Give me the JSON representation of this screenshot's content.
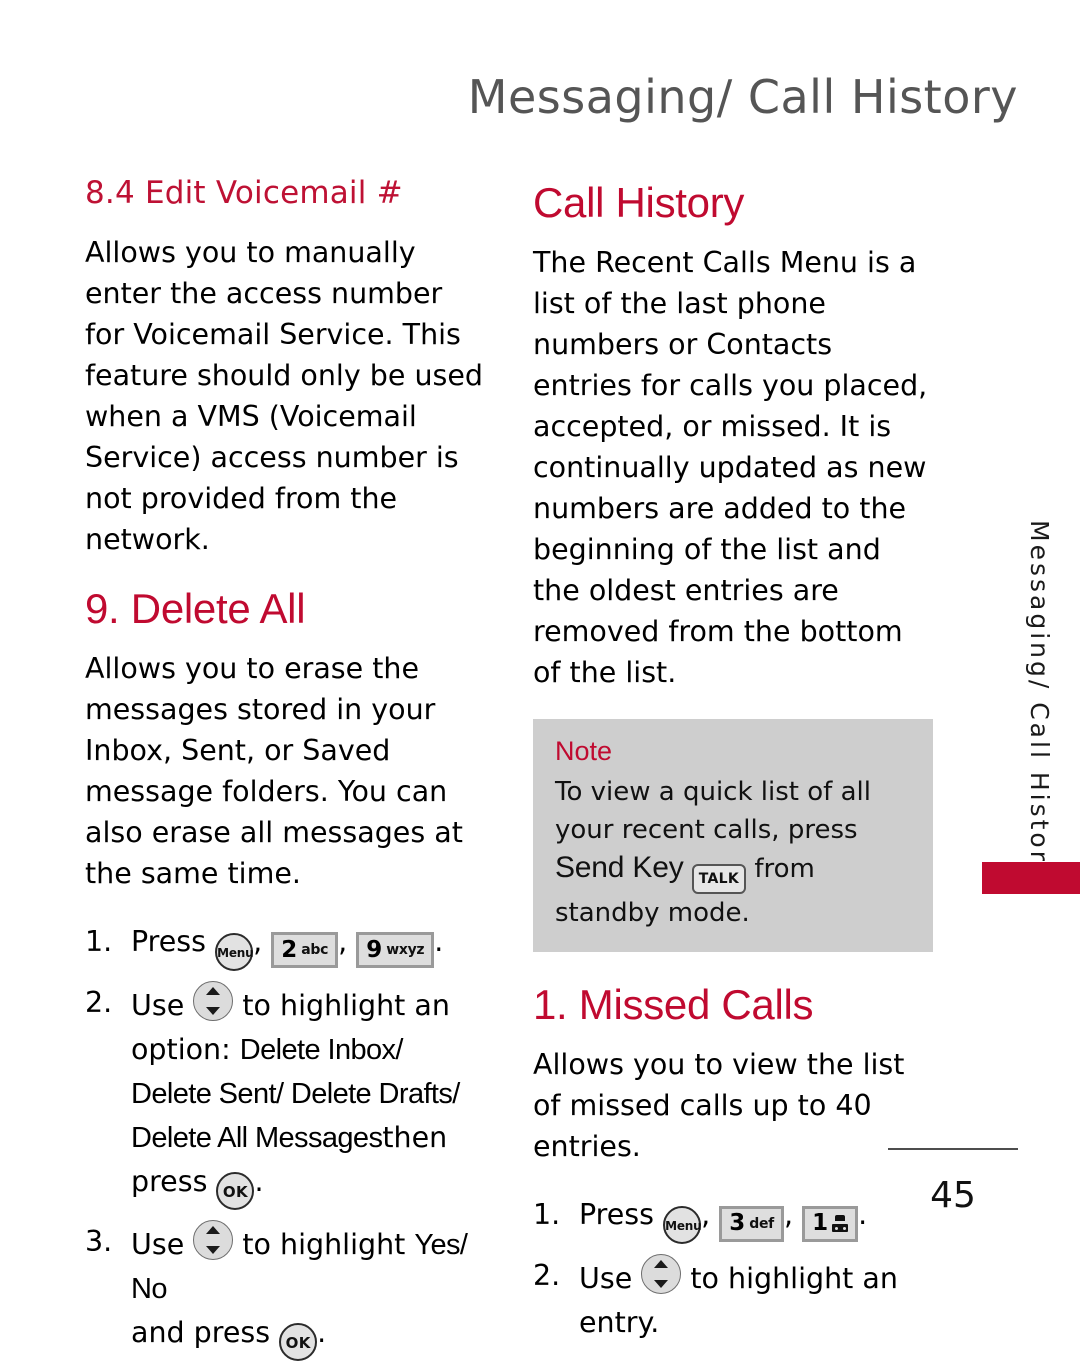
{
  "header": {
    "running_head": "Messaging/ Call History"
  },
  "left_column": {
    "section_heading": "8.4 Edit Voicemail #",
    "section_paragraph": "Allows you to manually enter the access number for Voicemail Service. This feature should only be used when a VMS (Voicemail Service) access number is not provided from the network.",
    "subsection_heading": "9. Delete All",
    "subsection_paragraph": "Allows you to erase the messages stored in your Inbox, Sent, or Saved message folders. You can also erase all messages at the same time.",
    "steps": {
      "step1_num": "1.",
      "step1_press": "Press",
      "step1_comma1": ",",
      "step1_comma2": ",",
      "step1_period": ".",
      "step2_num": "2.",
      "step2_use": "Use",
      "step2_text": "to highlight an",
      "step2_option_label": "option:",
      "step2_options": "Delete Inbox/ Delete Sent/ Delete Drafts/ Delete All Messages",
      "step2_then": "then press",
      "step2_period": ".",
      "step3_num": "3.",
      "step3_use": "Use",
      "step3_text": "to highlight",
      "step3_choices": "Yes/ No",
      "step3_and_press": "and press",
      "step3_period": "."
    },
    "keys": {
      "menu_label": "Menu",
      "key2_digit": "2",
      "key2_letters": "abc",
      "key9_digit": "9",
      "key9_letters": "wxyz",
      "ok_label": "OK"
    }
  },
  "right_column": {
    "section_heading": "Call History",
    "section_paragraph": "The Recent Calls Menu is a list of the last phone numbers or Contacts entries for calls you placed, accepted, or missed. It is continually updated as new numbers are added to the beginning of the list and the oldest entries are removed from the bottom of the list.",
    "note": {
      "title": "Note",
      "text_before": "To view a quick list of all your recent calls, press",
      "send_key": "Send Key",
      "talk_key_label": "TALK",
      "text_after": "from standby mode."
    },
    "subsection_heading": "1. Missed Calls",
    "subsection_paragraph": "Allows you to view the list of missed calls up to 40 entries.",
    "steps": {
      "step1_num": "1.",
      "step1_press": "Press",
      "step1_comma1": ",",
      "step1_comma2": ",",
      "step1_period": ".",
      "step2_num": "2.",
      "step2_use": "Use",
      "step2_text": "to highlight an entry."
    },
    "keys": {
      "menu_label": "Menu",
      "key3_digit": "3",
      "key3_letters": "def",
      "key1_digit": "1"
    }
  },
  "side_tab": {
    "label": "Messaging/ Call History"
  },
  "footer": {
    "page_number": "45"
  },
  "colors": {
    "accent_red": "#C00A30",
    "heading_red": "#BE1134",
    "note_bg": "#CECECE",
    "running_head_gray": "#555555"
  }
}
